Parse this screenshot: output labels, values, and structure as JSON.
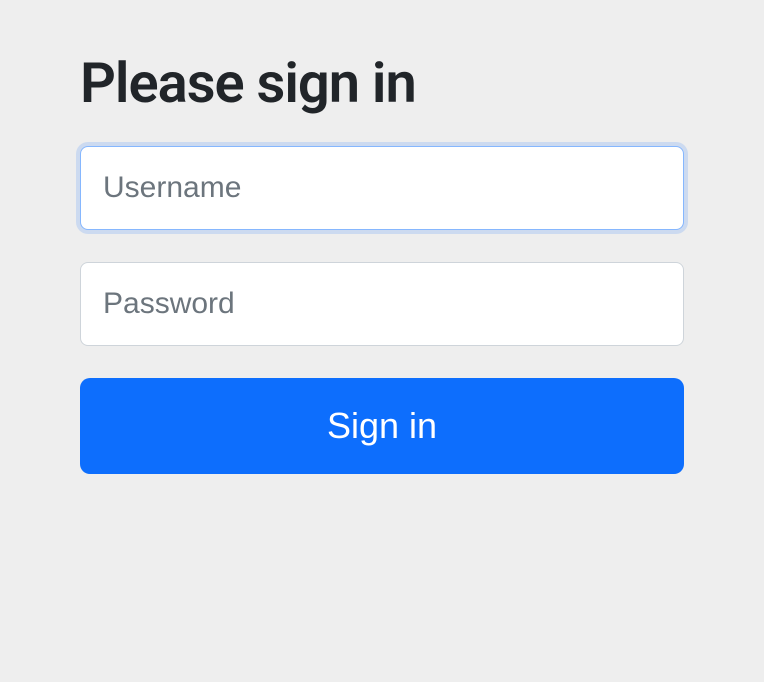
{
  "form": {
    "title": "Please sign in",
    "username": {
      "placeholder": "Username",
      "value": ""
    },
    "password": {
      "placeholder": "Password",
      "value": ""
    },
    "submit_label": "Sign in"
  }
}
